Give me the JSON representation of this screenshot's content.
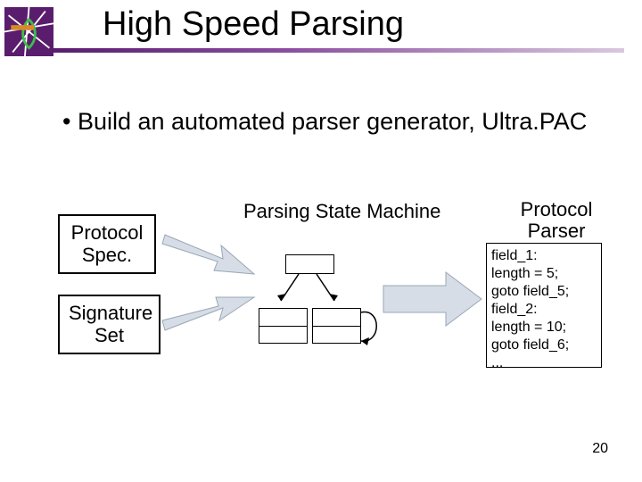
{
  "slide": {
    "title": "High Speed Parsing",
    "bullet_text": "Build an automated parser generator, Ultra.PAC",
    "page_number": "20"
  },
  "diagram": {
    "box_protocol_spec": "Protocol Spec.",
    "box_signature_set": "Signature Set",
    "label_parsing_state_machine": "Parsing State Machine",
    "label_protocol_parser": "Protocol Parser",
    "code_lines": [
      "field_1:",
      " length = 5;",
      " goto field_5;",
      "field_2:",
      " length = 10;",
      " goto field_6;",
      "..."
    ]
  },
  "colors": {
    "accent": "#5a1d6e",
    "arrow_fill": "#d6dde6",
    "arrow_stroke": "#9aa7b5"
  }
}
